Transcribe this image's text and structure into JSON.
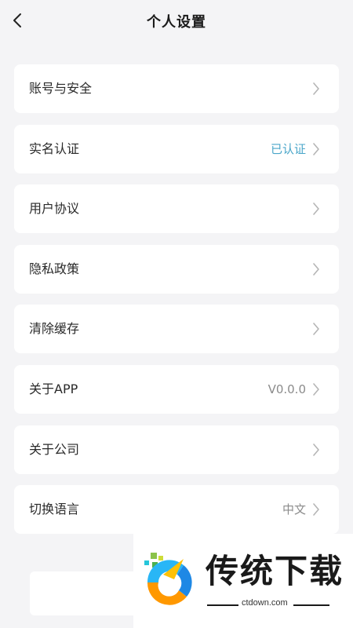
{
  "header": {
    "title": "个人设置",
    "back_icon": "chevron-left-icon"
  },
  "menu": {
    "items": [
      {
        "label": "账号与安全",
        "value": ""
      },
      {
        "label": "实名认证",
        "value": "已认证",
        "value_color": "#4aa6c9"
      },
      {
        "label": "用户协议",
        "value": ""
      },
      {
        "label": "隐私政策",
        "value": ""
      },
      {
        "label": "清除缓存",
        "value": ""
      },
      {
        "label": "关于APP",
        "value": "V0.0.0"
      },
      {
        "label": "关于公司",
        "value": ""
      },
      {
        "label": "切换语言",
        "value": "中文"
      }
    ]
  },
  "watermark": {
    "brand": "传统下载",
    "url": "ctdown.com"
  },
  "colors": {
    "background": "#f4f4f6",
    "card": "#ffffff",
    "text_primary": "#2a2a2a",
    "text_secondary": "#8b8b8b",
    "accent": "#4aa6c9"
  }
}
